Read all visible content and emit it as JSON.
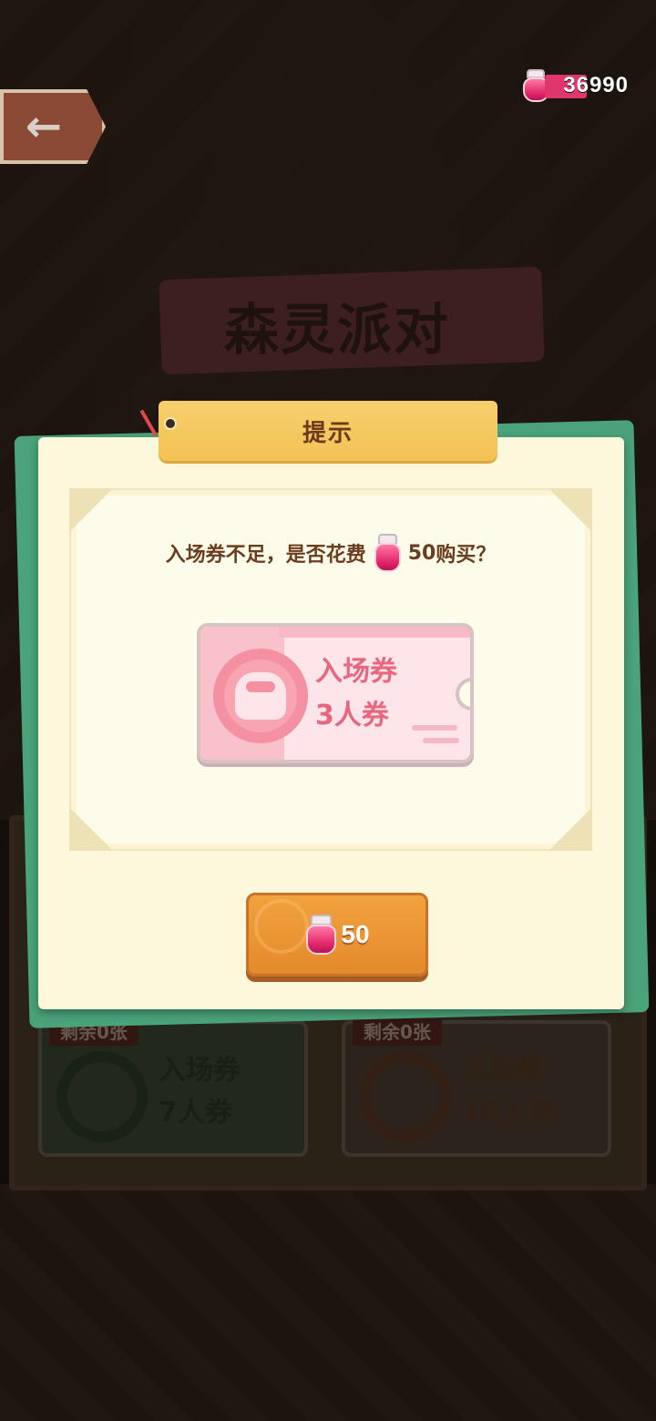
{
  "currency": {
    "value": "36990",
    "icon": "jam-jar-icon"
  },
  "background": {
    "event_title": "森灵派对",
    "tickets": [
      {
        "remaining_label": "剩余0张",
        "name": "入场券",
        "type": "7人券",
        "color": "#4c8a5a"
      },
      {
        "remaining_label": "剩余0张",
        "name": "入场券",
        "type": "10人券",
        "color": "#d67a2c"
      }
    ]
  },
  "dialog": {
    "title": "提示",
    "message_before": "入场券不足，是否花费",
    "message_amount": "50",
    "message_after": "购买？",
    "ticket": {
      "name": "入场券",
      "type": "3人券"
    },
    "buy_button": {
      "price": "50"
    }
  },
  "colors": {
    "accent_pink": "#e2236a",
    "button_orange": "#e48a2c",
    "dialog_bg": "#fdf8dc",
    "title_yellow": "#f2c256"
  }
}
